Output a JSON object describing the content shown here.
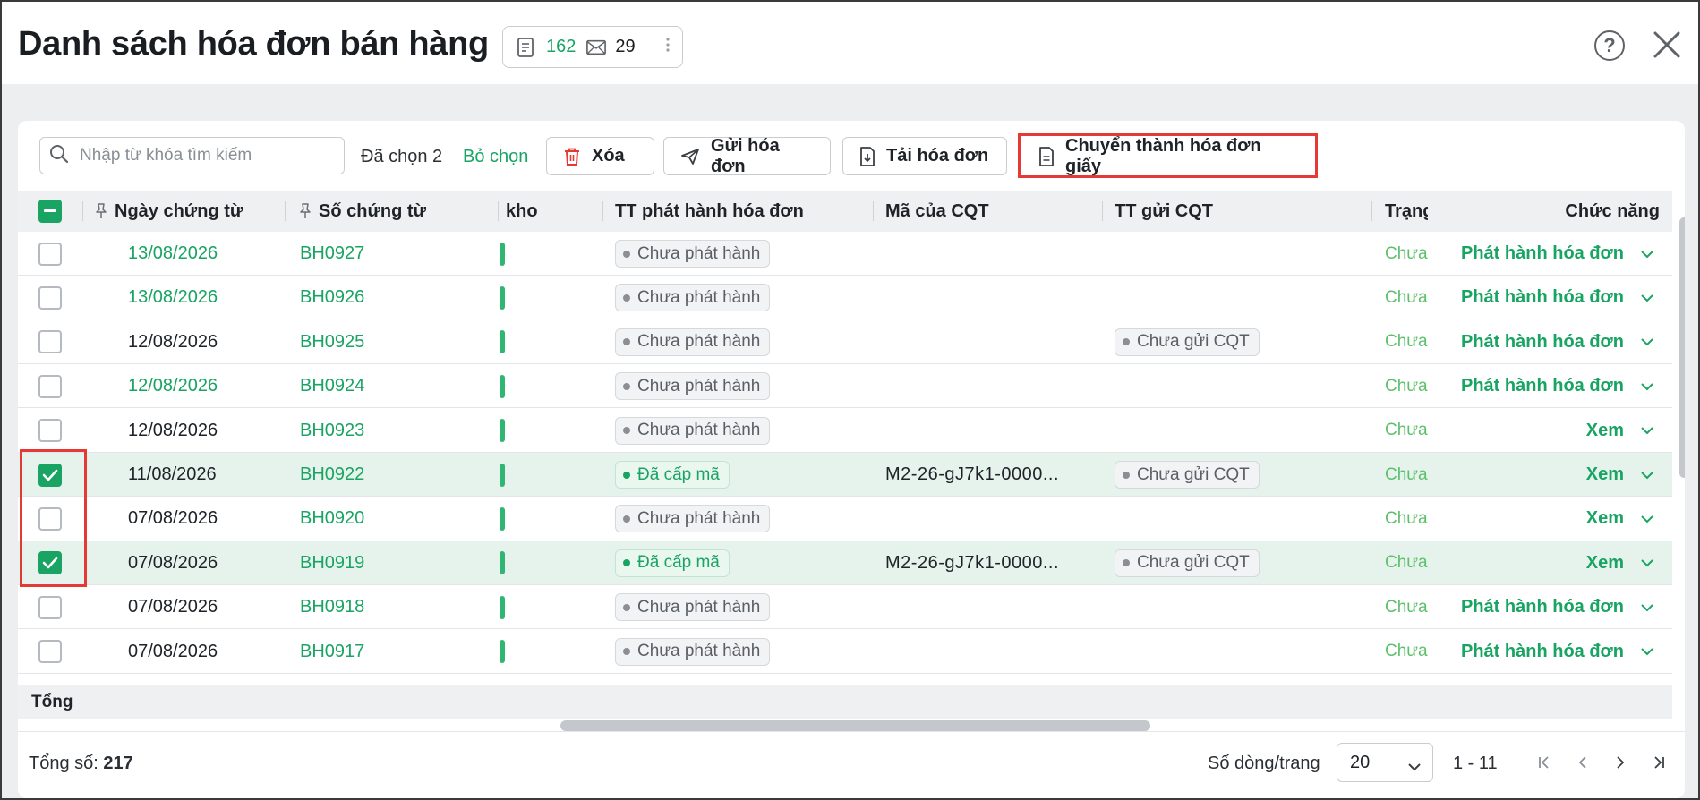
{
  "header": {
    "title": "Danh sách hóa đơn bán hàng",
    "count_documents": "162",
    "count_mail": "29"
  },
  "toolbar": {
    "search_placeholder": "Nhập từ khóa tìm kiếm",
    "selected_text": "Đã chọn 2",
    "unselect_label": "Bỏ chọn",
    "delete_label": "Xóa",
    "send_label": "Gửi hóa đơn",
    "download_label": "Tải hóa đơn",
    "convert_label": "Chuyển thành hóa đơn giấy"
  },
  "table": {
    "columns": {
      "date": "Ngày chứng từ",
      "code": "Số chứng từ",
      "kho": "kho",
      "tt_phat_hanh": "TT phát hành hóa đơn",
      "ma_cqt": "Mã của CQT",
      "tt_gui_cqt": "TT gửi CQT",
      "trang": "Trạng",
      "chuc_nang": "Chức năng"
    },
    "rows": [
      {
        "checked": false,
        "date": "13/08/2026",
        "date_color": "green",
        "code": "BH0927",
        "tt_phat_hanh": "Chưa phát hành",
        "tt_status": "grey",
        "ma_cqt": "",
        "tt_gui_cqt": "",
        "trang": "Chưa",
        "action": "Phát hành hóa đơn"
      },
      {
        "checked": false,
        "date": "13/08/2026",
        "date_color": "green",
        "code": "BH0926",
        "tt_phat_hanh": "Chưa phát hành",
        "tt_status": "grey",
        "ma_cqt": "",
        "tt_gui_cqt": "",
        "trang": "Chưa",
        "action": "Phát hành hóa đơn"
      },
      {
        "checked": false,
        "date": "12/08/2026",
        "date_color": "dark",
        "code": "BH0925",
        "tt_phat_hanh": "Chưa phát hành",
        "tt_status": "grey",
        "ma_cqt": "",
        "tt_gui_cqt": "Chưa gửi CQT",
        "trang": "Chưa",
        "action": "Phát hành hóa đơn"
      },
      {
        "checked": false,
        "date": "12/08/2026",
        "date_color": "green",
        "code": "BH0924",
        "tt_phat_hanh": "Chưa phát hành",
        "tt_status": "grey",
        "ma_cqt": "",
        "tt_gui_cqt": "",
        "trang": "Chưa",
        "action": "Phát hành hóa đơn"
      },
      {
        "checked": false,
        "date": "12/08/2026",
        "date_color": "dark",
        "code": "BH0923",
        "tt_phat_hanh": "Chưa phát hành",
        "tt_status": "grey",
        "ma_cqt": "",
        "tt_gui_cqt": "",
        "trang": "Chưa",
        "action": "Xem"
      },
      {
        "checked": true,
        "date": "11/08/2026",
        "date_color": "dark",
        "code": "BH0922",
        "tt_phat_hanh": "Đã cấp mã",
        "tt_status": "green",
        "ma_cqt": "M2-26-gJ7k1-0000...",
        "tt_gui_cqt": "Chưa gửi CQT",
        "trang": "Chưa",
        "action": "Xem"
      },
      {
        "checked": false,
        "date": "07/08/2026",
        "date_color": "dark",
        "code": "BH0920",
        "tt_phat_hanh": "Chưa phát hành",
        "tt_status": "grey",
        "ma_cqt": "",
        "tt_gui_cqt": "",
        "trang": "Chưa",
        "action": "Xem"
      },
      {
        "checked": true,
        "date": "07/08/2026",
        "date_color": "dark",
        "code": "BH0919",
        "tt_phat_hanh": "Đã cấp mã",
        "tt_status": "green",
        "ma_cqt": "M2-26-gJ7k1-0000...",
        "tt_gui_cqt": "Chưa gửi CQT",
        "trang": "Chưa",
        "action": "Xem"
      },
      {
        "checked": false,
        "date": "07/08/2026",
        "date_color": "dark",
        "code": "BH0918",
        "tt_phat_hanh": "Chưa phát hành",
        "tt_status": "grey",
        "ma_cqt": "",
        "tt_gui_cqt": "",
        "trang": "Chưa",
        "action": "Phát hành hóa đơn"
      },
      {
        "checked": false,
        "date": "07/08/2026",
        "date_color": "dark",
        "code": "BH0917",
        "tt_phat_hanh": "Chưa phát hành",
        "tt_status": "grey",
        "ma_cqt": "",
        "tt_gui_cqt": "",
        "trang": "Chưa",
        "action": "Phát hành hóa đơn"
      }
    ],
    "total_label": "Tổng"
  },
  "footer": {
    "total_label": "Tổng số:",
    "total_value": "217",
    "per_page_label": "Số dòng/trang",
    "per_page_value": "20",
    "range": "1 - 11"
  },
  "colors": {
    "accent_green": "#19a463",
    "highlight_red": "#e53935"
  },
  "icons": [
    "document-icon",
    "mail-icon",
    "more-icon",
    "help-icon",
    "close-icon",
    "search-icon",
    "trash-icon",
    "send-icon",
    "download-icon",
    "paper-icon",
    "pin-icon",
    "chevron-down-icon",
    "first-page-icon",
    "prev-page-icon",
    "next-page-icon",
    "last-page-icon"
  ]
}
